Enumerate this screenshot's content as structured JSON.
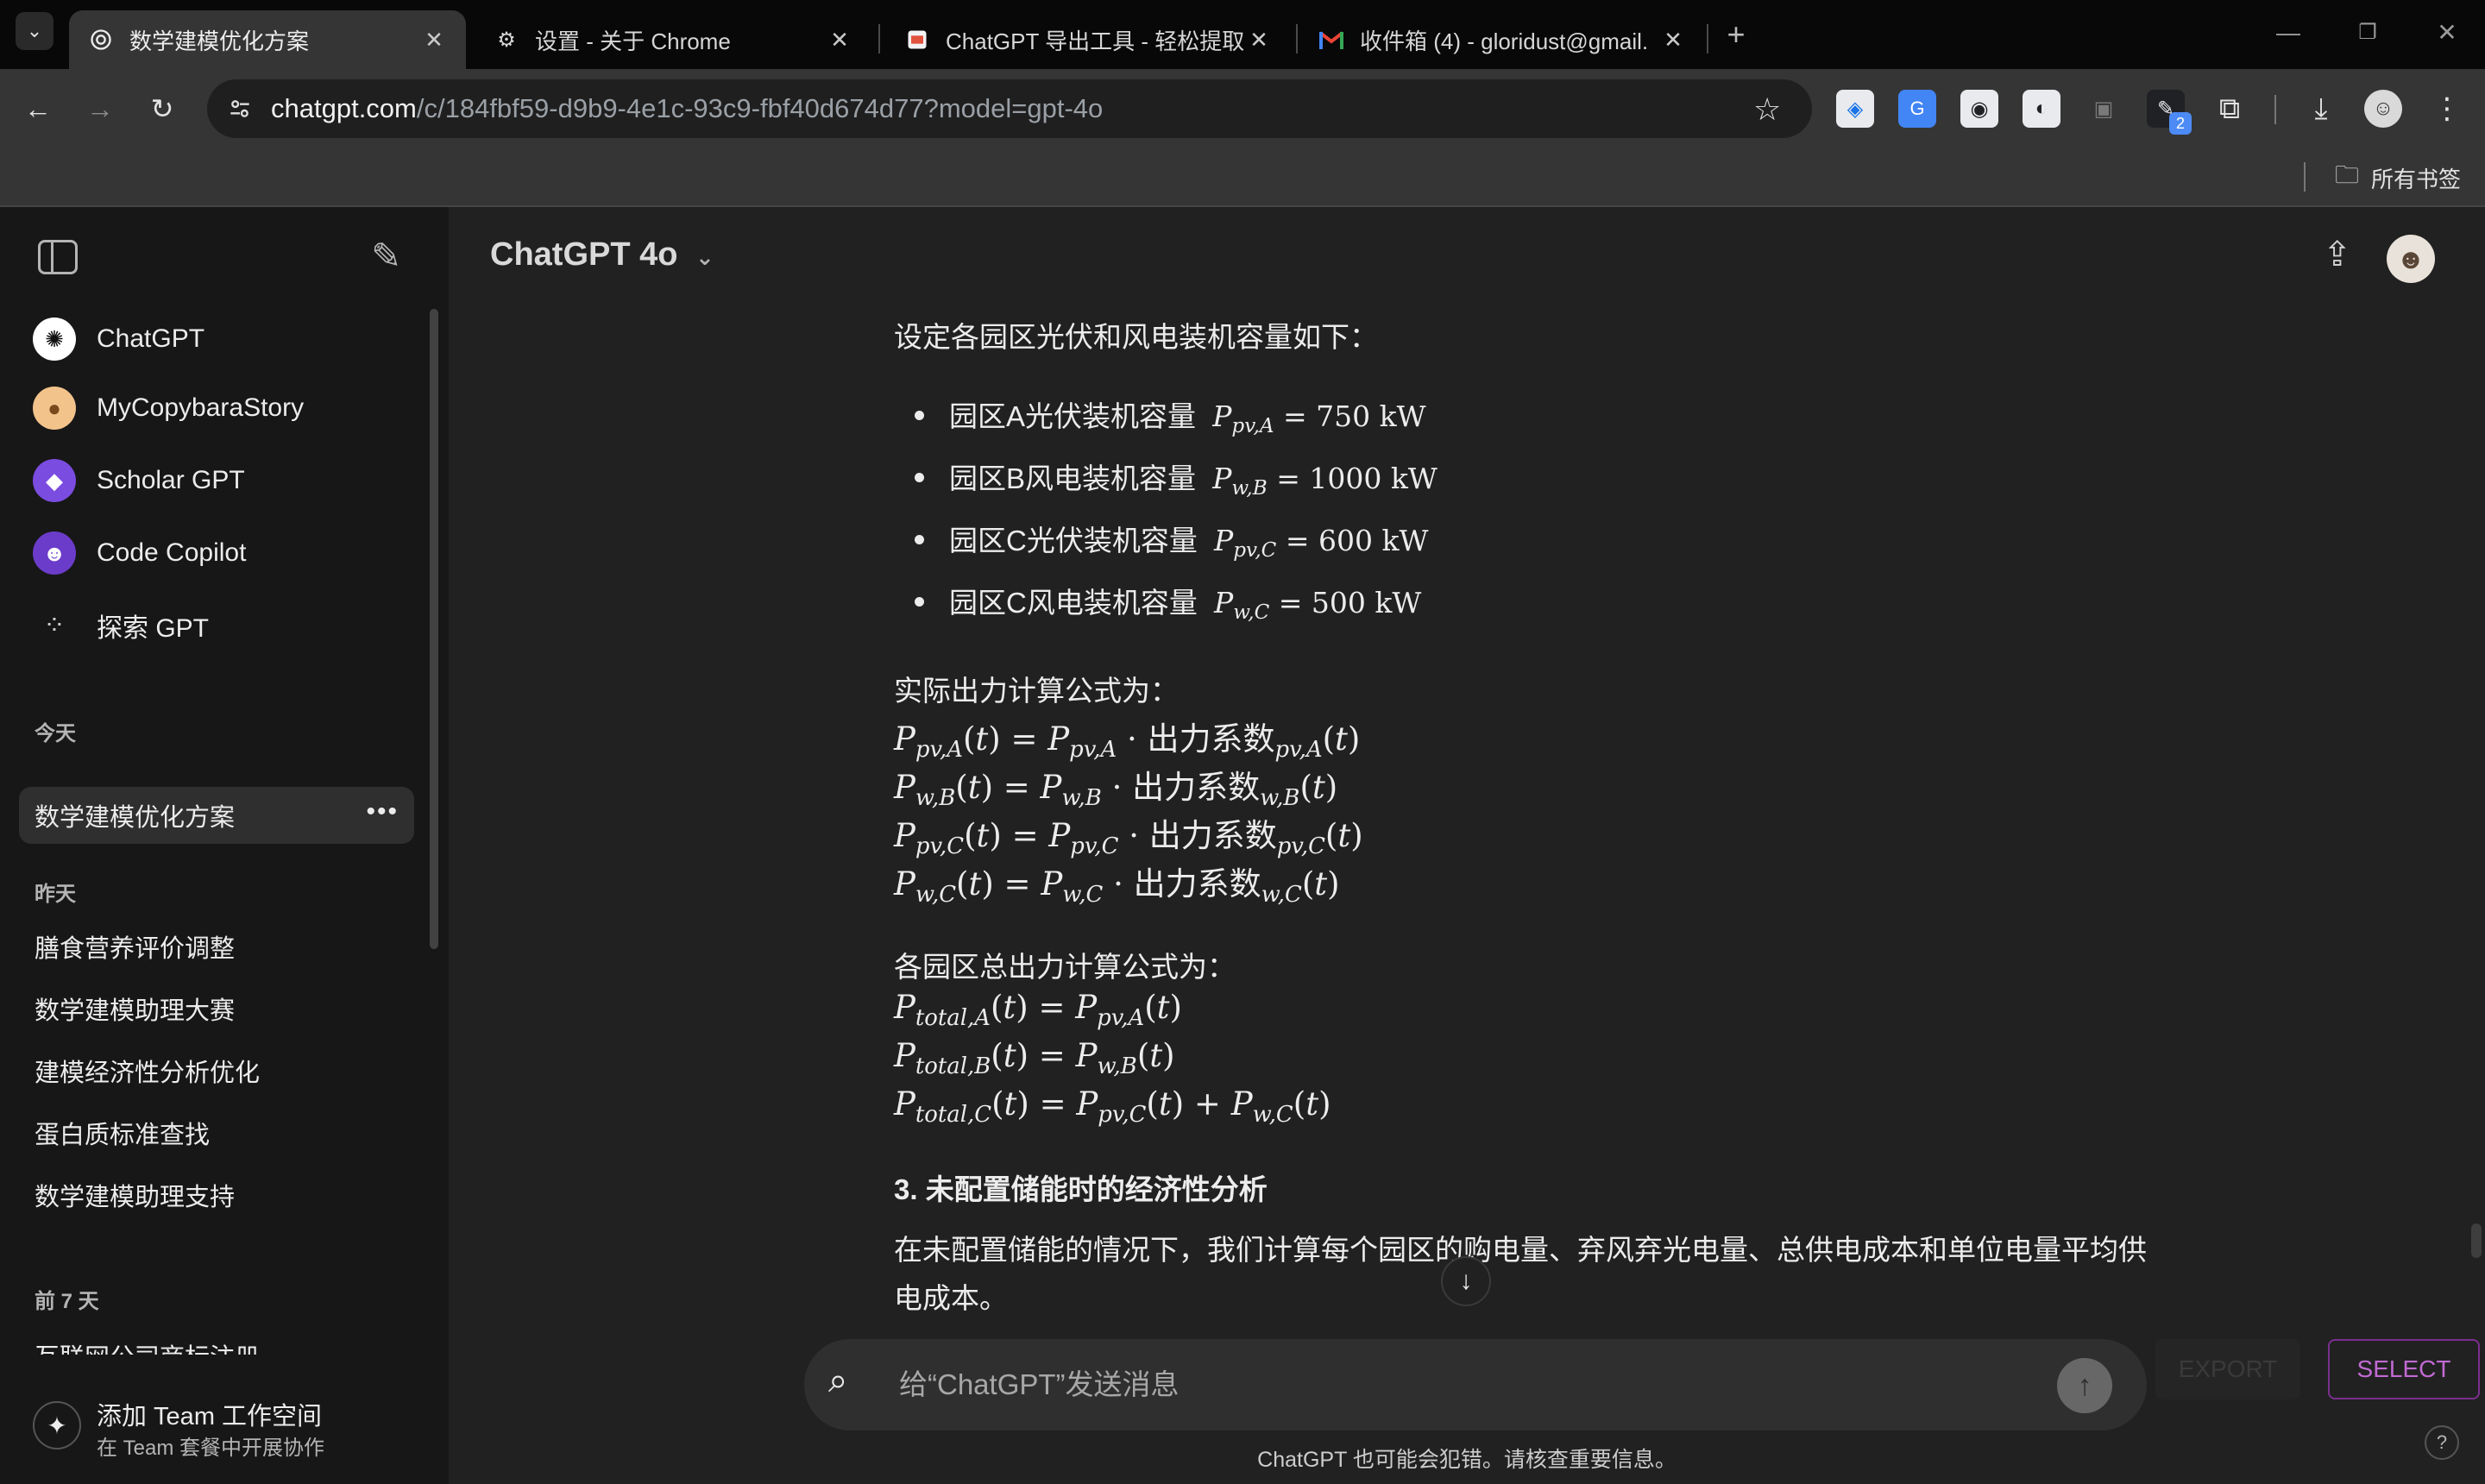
{
  "browser": {
    "tabs": [
      {
        "title": "数学建模优化方案",
        "icon": "openai-icon",
        "active": true
      },
      {
        "title": "设置 - 关于 Chrome",
        "icon": "gear-icon",
        "active": false
      },
      {
        "title": "ChatGPT 导出工具 - 轻松提取",
        "icon": "extension-icon",
        "active": false
      },
      {
        "title": "收件箱 (4) - gloridust@gmail.",
        "icon": "gmail-icon",
        "active": false
      }
    ],
    "url_host": "chatgpt.com",
    "url_path": "/c/184fbf59-d9b9-4e1c-93c9-fbf40d674d77?model=gpt-4o",
    "bookmarks_label": "所有书签",
    "extension_badge": "2"
  },
  "sidebar": {
    "gpts": [
      {
        "label": "ChatGPT",
        "icon": "openai-icon"
      },
      {
        "label": "MyCopybaraStory",
        "icon": "capybara-avatar"
      },
      {
        "label": "Scholar GPT",
        "icon": "scholar-avatar"
      },
      {
        "label": "Code Copilot",
        "icon": "copilot-avatar"
      },
      {
        "label": "探索 GPT",
        "icon": "grid-icon"
      }
    ],
    "today_label": "今天",
    "today_items": [
      "数学建模优化方案"
    ],
    "yesterday_label": "昨天",
    "yesterday_items": [
      "膳食营养评价调整",
      "数学建模助理大赛",
      "建模经济性分析优化",
      "蛋白质标准查找",
      "数学建模助理支持"
    ],
    "week_label": "前 7 天",
    "week_items": [
      "互联网公司商标注册"
    ],
    "team_title": "添加 Team 工作空间",
    "team_subtitle": "在 Team 套餐中开展协作"
  },
  "main": {
    "model_title": "ChatGPT 4o",
    "intro": "设定各园区光伏和风电装机容量如下：",
    "capacities": [
      {
        "label": "园区A光伏装机容量",
        "sym": "P",
        "sub": "pv,A",
        "value": "750 kW"
      },
      {
        "label": "园区B风电装机容量",
        "sym": "P",
        "sub": "w,B",
        "value": "1000 kW"
      },
      {
        "label": "园区C光伏装机容量",
        "sym": "P",
        "sub": "pv,C",
        "value": "600 kW"
      },
      {
        "label": "园区C风电装机容量",
        "sym": "P",
        "sub": "w,C",
        "value": "500 kW"
      }
    ],
    "actual_heading": "实际出力计算公式为：",
    "actual_formulas": [
      {
        "sub": "pv,A",
        "coef": "出力系数",
        "coef_sub": "pv,A"
      },
      {
        "sub": "w,B",
        "coef": "出力系数",
        "coef_sub": "w,B"
      },
      {
        "sub": "pv,C",
        "coef": "出力系数",
        "coef_sub": "pv,C"
      },
      {
        "sub": "w,C",
        "coef": "出力系数",
        "coef_sub": "w,C"
      }
    ],
    "total_heading": "各园区总出力计算公式为：",
    "total_formulas": [
      {
        "lhs_sub": "total,A",
        "rhs": [
          {
            "sub": "pv,A"
          }
        ]
      },
      {
        "lhs_sub": "total,B",
        "rhs": [
          {
            "sub": "w,B"
          }
        ]
      },
      {
        "lhs_sub": "total,C",
        "rhs": [
          {
            "sub": "pv,C"
          },
          {
            "sub": "w,C"
          }
        ]
      }
    ],
    "section3_title": "3. 未配置储能时的经济性分析",
    "section3_line1": "在未配置储能的情况下，我们计算每个园区的购电量、弃风弃光电量、总供电成本和单位电量平均供",
    "section3_line2": "电成本。",
    "composer_placeholder": "给“ChatGPT”发送消息",
    "disclaimer": "ChatGPT 也可能会犯错。请核查重要信息。",
    "export_label": "EXPORT",
    "select_label": "SELECT",
    "help_label": "?"
  }
}
